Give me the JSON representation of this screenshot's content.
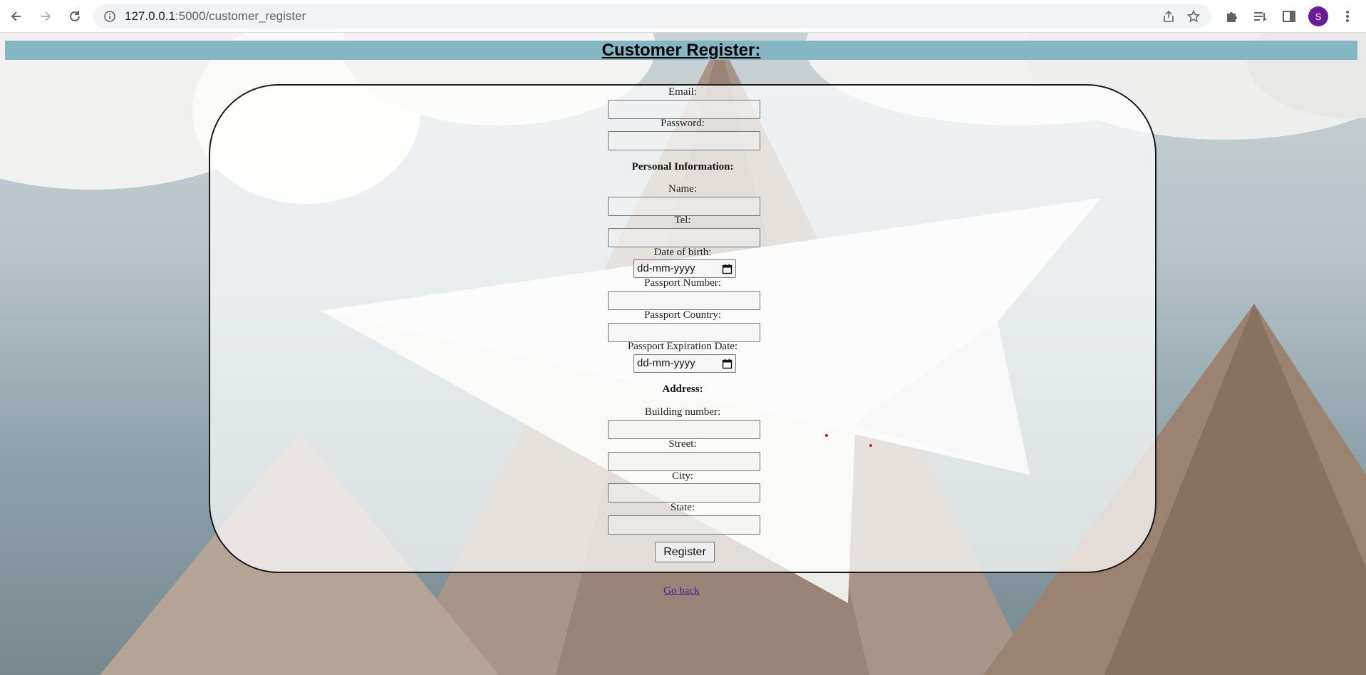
{
  "browser": {
    "url_host": "127.0.0.1",
    "url_path": ":5000/customer_register",
    "avatar_letter": "S",
    "avatar_color": "#6a1b9a",
    "icons": [
      "back-arrow-icon",
      "forward-arrow-icon",
      "reload-icon",
      "site-info-icon",
      "share-icon",
      "bookmark-star-icon",
      "extensions-puzzle-icon",
      "reading-list-icon",
      "side-panel-icon",
      "kebab-menu-icon"
    ]
  },
  "page": {
    "title": "Customer Register:",
    "header_color": "#84b6c3",
    "form": {
      "email_label": "Email:",
      "password_label": "Password:",
      "personal_heading": "Personal Information:",
      "name_label": "Name:",
      "tel_label": "Tel:",
      "dob_label": "Date of birth:",
      "dob_placeholder": "dd-mm-yyyy",
      "passport_number_label": "Passport Number:",
      "passport_country_label": "Passport Country:",
      "passport_expiration_label": "Passport Expiration Date:",
      "passport_expiration_placeholder": "dd-mm-yyyy",
      "address_heading": "Address:",
      "building_label": "Building number:",
      "street_label": "Street:",
      "city_label": "City:",
      "state_label": "State:",
      "submit_label": "Register"
    },
    "go_back_link": "Go back",
    "link_color": "#551a8b"
  }
}
